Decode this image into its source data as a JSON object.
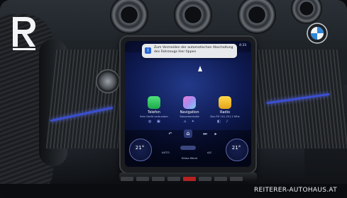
{
  "branding": {
    "dealer_logo_letter": "R",
    "car_brand_logo": "BMW",
    "website": "REITERER-AUTOHAUS.AT"
  },
  "screen": {
    "time": "4:33",
    "notification": {
      "icon": "info-icon",
      "text": "Zum Vermeiden der automatischen Abschaltung des Fahrzeugs hier tippen"
    },
    "apps": [
      {
        "label": "Telefon",
        "sub": "Kein Gerät verbunden",
        "icon": "phone-icon",
        "color": "#2ec45a"
      },
      {
        "label": "Navigation",
        "sub": "Steuerkontrolle",
        "icon": "navigation-icon",
        "color": "#c88ce8"
      },
      {
        "label": "Radio",
        "sub": "Bus FM 101.251.2 MHz",
        "icon": "radio-icon",
        "color": "#f2c12e"
      }
    ],
    "climate": {
      "left_temp": "21°",
      "right_temp": "21°",
      "auto_label": "AUTO",
      "menu_label": "Klima Menü",
      "ac_label": "A/C"
    }
  },
  "colors": {
    "ambient": "#3a4fd0",
    "screen_bg": "#0e1a52"
  }
}
